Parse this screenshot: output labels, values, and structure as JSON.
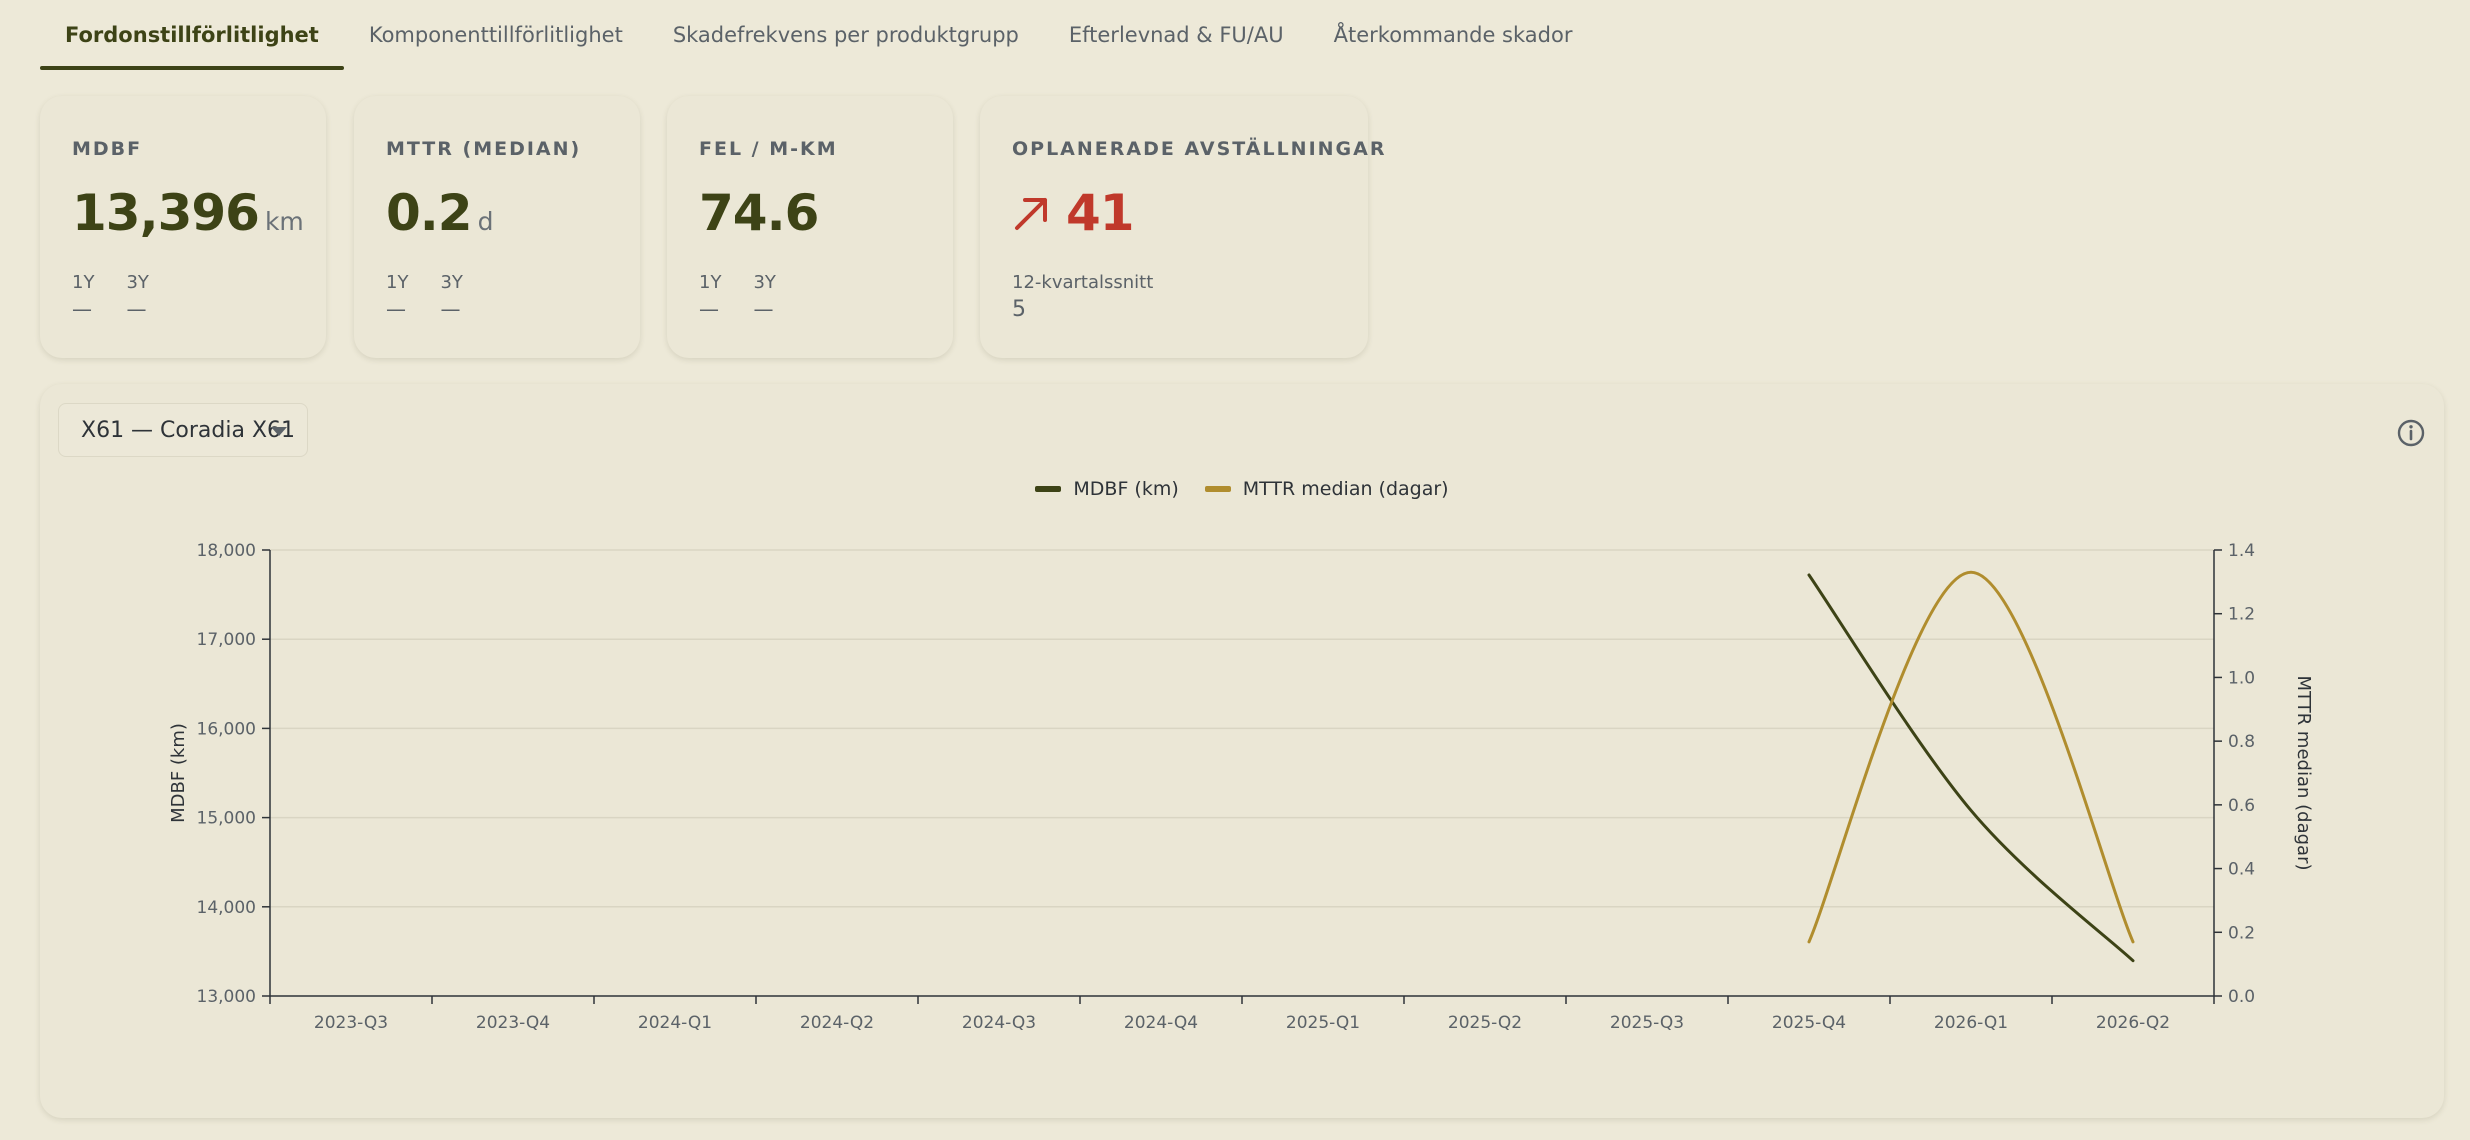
{
  "tabs": [
    {
      "label": "Fordonstillförlitlighet",
      "active": true
    },
    {
      "label": "Komponenttillförlitlighet",
      "active": false
    },
    {
      "label": "Skadefrekvens per produktgrupp",
      "active": false
    },
    {
      "label": "Efterlevnad & FU/AU",
      "active": false
    },
    {
      "label": "Återkommande skador",
      "active": false
    }
  ],
  "kpis": {
    "mdbf": {
      "title": "MDBF",
      "value": "13,396",
      "unit": "km",
      "p1_label": "1Y",
      "p1_value": "—",
      "p3_label": "3Y",
      "p3_value": "—"
    },
    "mttr": {
      "title": "MTTR (MEDIAN)",
      "value": "0.2",
      "unit": "d",
      "p1_label": "1Y",
      "p1_value": "—",
      "p3_label": "3Y",
      "p3_value": "—"
    },
    "fel": {
      "title": "FEL / M-KM",
      "value": "74.6",
      "p1_label": "1Y",
      "p1_value": "—",
      "p3_label": "3Y",
      "p3_value": "—"
    },
    "avst": {
      "title": "OPLANERADE AVSTÄLLNINGAR",
      "value": "41",
      "avg_label": "12-kvartalssnitt",
      "avg_value": "5",
      "trend_icon": "arrow-up-right-icon",
      "color": "#c0392b"
    }
  },
  "chart_panel": {
    "selector_value": "X61 — Coradia X61",
    "info_icon": "info-icon"
  },
  "chart_data": {
    "type": "line",
    "categories": [
      "2023-Q3",
      "2023-Q4",
      "2024-Q1",
      "2024-Q2",
      "2024-Q3",
      "2024-Q4",
      "2025-Q1",
      "2025-Q2",
      "2025-Q3",
      "2025-Q4",
      "2026-Q1",
      "2026-Q2"
    ],
    "series": [
      {
        "name": "MDBF (km)",
        "axis": "left",
        "color": "#3d4316",
        "values": [
          null,
          null,
          null,
          null,
          null,
          null,
          null,
          null,
          null,
          17720,
          15080,
          13396
        ]
      },
      {
        "name": "MTTR median (dagar)",
        "axis": "right",
        "color": "#b08d2e",
        "values": [
          null,
          null,
          null,
          null,
          null,
          null,
          null,
          null,
          null,
          0.17,
          1.33,
          0.17
        ]
      }
    ],
    "ylabel_left": "MDBF (km)",
    "ylabel_right": "MTTR median (dagar)",
    "ylim_left": [
      13000,
      18000
    ],
    "yticks_left": [
      "13,000",
      "14,000",
      "15,000",
      "16,000",
      "17,000",
      "18,000"
    ],
    "ylim_right": [
      0,
      1.4
    ],
    "yticks_right": [
      "0.0",
      "0.2",
      "0.4",
      "0.6",
      "0.8",
      "1.0",
      "1.2",
      "1.4"
    ],
    "grid": true,
    "legend_position": "top-center"
  }
}
